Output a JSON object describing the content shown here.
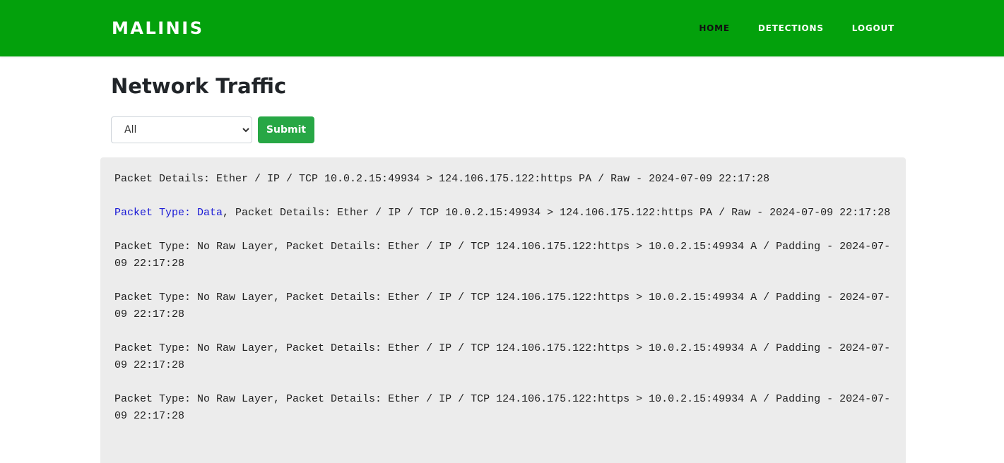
{
  "navbar": {
    "brand": "MALINIS",
    "links": [
      {
        "label": "HOME",
        "active": true
      },
      {
        "label": "DETECTIONS",
        "active": false
      },
      {
        "label": "LOGOUT",
        "active": false
      }
    ]
  },
  "page": {
    "title": "Network Traffic"
  },
  "filter": {
    "selected": "All",
    "submit_label": "Submit"
  },
  "packets": [
    {
      "prefix": "",
      "text": "Packet Details: Ether / IP / TCP 10.0.2.15:49934 > 124.106.175.122:https PA / Raw - 2024-07-09 22:17:28"
    },
    {
      "prefix": "Packet Type: Data",
      "text": ", Packet Details: Ether / IP / TCP 10.0.2.15:49934 > 124.106.175.122:https PA / Raw - 2024-07-09 22:17:28"
    },
    {
      "prefix": "",
      "text": "Packet Type: No Raw Layer, Packet Details: Ether / IP / TCP 124.106.175.122:https > 10.0.2.15:49934 A / Padding - 2024-07-09 22:17:28"
    },
    {
      "prefix": "",
      "text": "Packet Type: No Raw Layer, Packet Details: Ether / IP / TCP 124.106.175.122:https > 10.0.2.15:49934 A / Padding - 2024-07-09 22:17:28"
    },
    {
      "prefix": "",
      "text": "Packet Type: No Raw Layer, Packet Details: Ether / IP / TCP 124.106.175.122:https > 10.0.2.15:49934 A / Padding - 2024-07-09 22:17:28"
    },
    {
      "prefix": "",
      "text": "Packet Type: No Raw Layer, Packet Details: Ether / IP / TCP 124.106.175.122:https > 10.0.2.15:49934 A / Padding - 2024-07-09 22:17:28"
    }
  ]
}
